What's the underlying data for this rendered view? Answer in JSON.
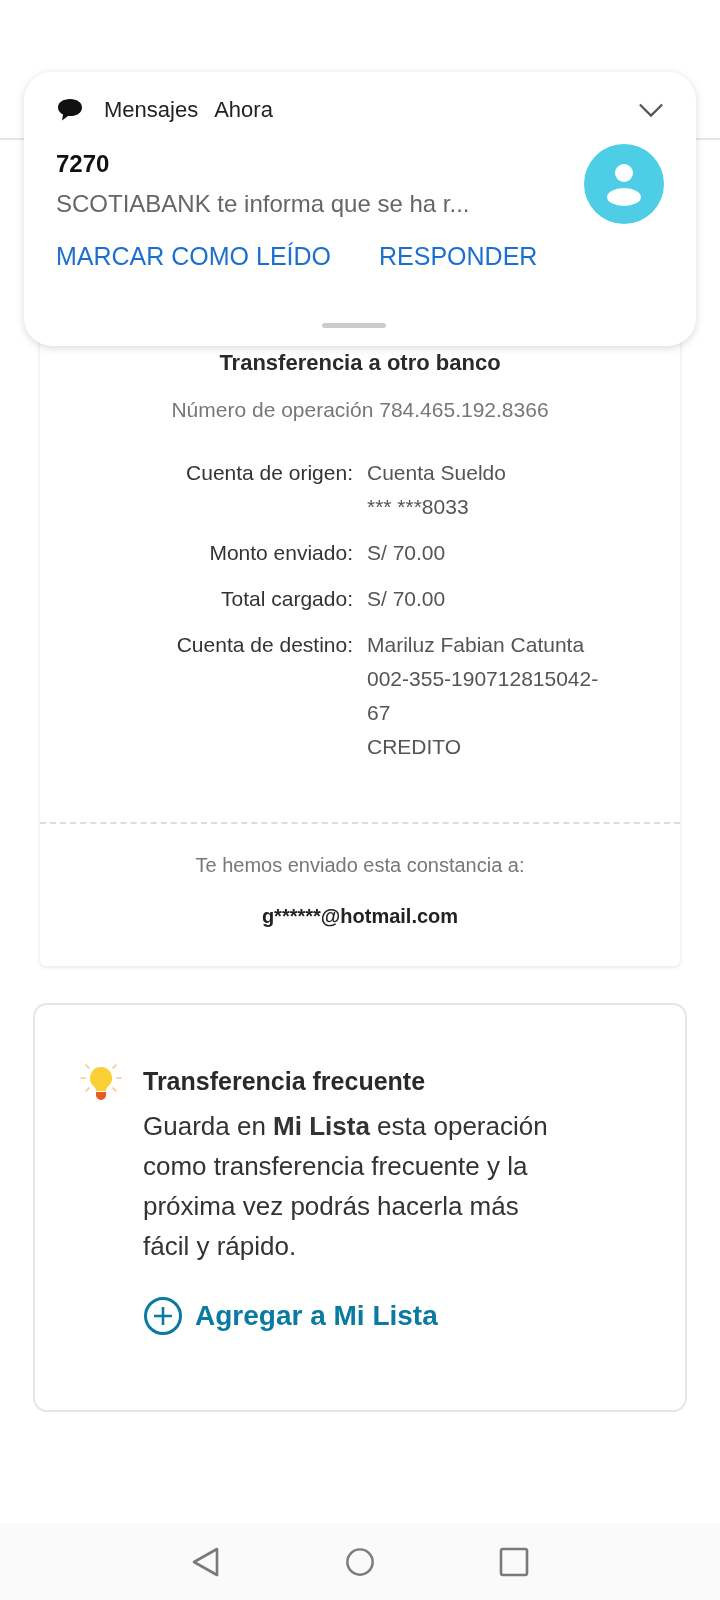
{
  "notification": {
    "app": "Mensajes",
    "time": "Ahora",
    "sender": "7270",
    "message": "SCOTIABANK te informa que se ha r...",
    "actions": [
      "MARCAR COMO LEÍDO",
      "RESPONDER"
    ]
  },
  "receipt": {
    "title": "Transferencia a otro banco",
    "operation": "Número de operación 784.465.192.8366",
    "rows": [
      {
        "label": "Cuenta de origen:",
        "values": [
          "Cuenta Sueldo",
          "*** ***8033"
        ]
      },
      {
        "label": "Monto enviado:",
        "values": [
          "S/ 70.00"
        ]
      },
      {
        "label": "Total cargado:",
        "values": [
          "S/ 70.00"
        ]
      },
      {
        "label": "Cuenta de destino:",
        "values": [
          "Mariluz Fabian Catunta",
          "002-355-190712815042-",
          "67",
          "CREDITO"
        ]
      }
    ],
    "email_label": "Te hemos enviado esta constancia a:",
    "email": "g******@hotmail.com"
  },
  "tip": {
    "title": "Transferencia frecuente",
    "body": "Guarda en **Mi Lista** esta operación como transferencia frecuente y la próxima vez podrás hacerla más fácil y rápido.",
    "link": "Agregar a Mi Lista"
  }
}
